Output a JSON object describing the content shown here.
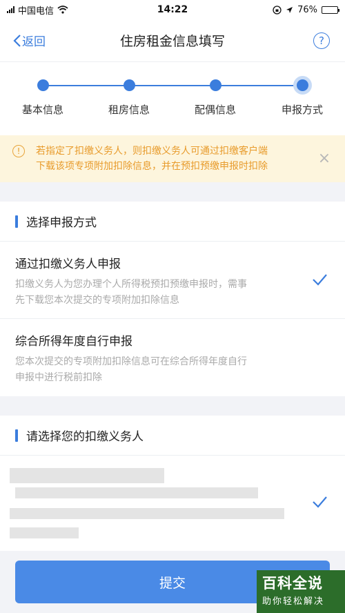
{
  "status_bar": {
    "carrier": "中国电信",
    "time": "14:22",
    "battery_percent": "76%",
    "battery_level": 0.76
  },
  "nav": {
    "back_label": "返回",
    "title": "住房租金信息填写",
    "help_icon": "?"
  },
  "steps": [
    {
      "label": "基本信息",
      "state": "done"
    },
    {
      "label": "租房信息",
      "state": "done"
    },
    {
      "label": "配偶信息",
      "state": "done"
    },
    {
      "label": "申报方式",
      "state": "active"
    }
  ],
  "notice": {
    "icon": "!",
    "line1": "若指定了扣缴义务人，则扣缴义务人可通过扣缴客户端",
    "line2": "下载该项专项附加扣除信息，并在预扣预缴申报时扣除",
    "close": "×"
  },
  "filing_section": {
    "title": "选择申报方式",
    "options": [
      {
        "title": "通过扣缴义务人申报",
        "desc1": "扣缴义务人为您办理个人所得税预扣预缴申报时，需事",
        "desc2": "先下载您本次提交的专项附加扣除信息",
        "selected": true
      },
      {
        "title": "综合所得年度自行申报",
        "desc1": "您本次提交的专项附加扣除信息可在综合所得年度自行",
        "desc2": "申报中进行税前扣除",
        "selected": false
      }
    ]
  },
  "agent_section": {
    "title": "请选择您的扣缴义务人",
    "selected": true
  },
  "submit_label": "提交",
  "watermark": {
    "main": "百科全说",
    "sub": "助你轻松解决"
  },
  "colors": {
    "accent": "#3b7ddd",
    "notice_bg": "#fdf5dd",
    "notice_text": "#e89b2b",
    "submit_bg": "#4a8ae6"
  }
}
